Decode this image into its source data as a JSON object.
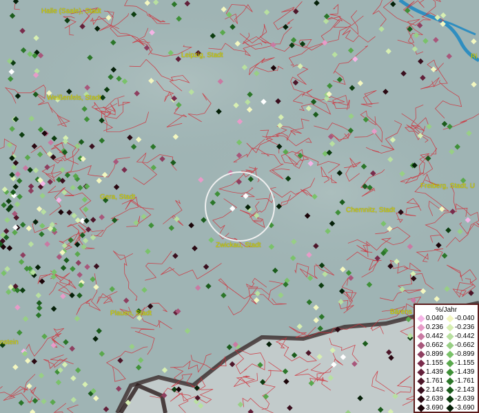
{
  "map": {
    "background_color": "#9fb4b4",
    "boundary_color": "#d0303a",
    "river_color": "#2f8ec0",
    "marker_circle_color": "#f0f0f0"
  },
  "cities": [
    {
      "id": "halle",
      "label": "Halle (Saale), Stadt"
    },
    {
      "id": "leipzig",
      "label": "Leipzig, Stadt"
    },
    {
      "id": "weissenfels",
      "label": "Weißenfels, Stadt"
    },
    {
      "id": "gera",
      "label": "Gera, Stadt"
    },
    {
      "id": "zwickau",
      "label": "Zwickau, Stadt"
    },
    {
      "id": "chemnitz",
      "label": "Chemnitz, Stadt"
    },
    {
      "id": "freiberg",
      "label": "Freiberg, Stadt, U"
    },
    {
      "id": "plauen",
      "label": "Plauen, Stadt"
    },
    {
      "id": "bärens",
      "label": "Bärens"
    },
    {
      "id": "stein",
      "label": "nstein"
    },
    {
      "id": "ri",
      "label": "Ri"
    }
  ],
  "legend": {
    "title": "%/Jahr",
    "positive": [
      {
        "value": "0.040",
        "color": "#f5b4e6"
      },
      {
        "value": "0.236",
        "color": "#e79bc8"
      },
      {
        "value": "0.442",
        "color": "#c97aa3"
      },
      {
        "value": "0.662",
        "color": "#a8577b"
      },
      {
        "value": "0.899",
        "color": "#8e3f60"
      },
      {
        "value": "1.155",
        "color": "#7a2c4c"
      },
      {
        "value": "1.439",
        "color": "#63203a"
      },
      {
        "value": "1.761",
        "color": "#4d1629"
      },
      {
        "value": "2.143",
        "color": "#3a0f1e"
      },
      {
        "value": "2.639",
        "color": "#2a0912"
      },
      {
        "value": "3.690",
        "color": "#1a0408"
      }
    ],
    "negative": [
      {
        "value": "-0.040",
        "color": "#f3f7c0"
      },
      {
        "value": "-0.236",
        "color": "#d7efb2"
      },
      {
        "value": "-0.442",
        "color": "#b8e0a0"
      },
      {
        "value": "-0.662",
        "color": "#98cf85"
      },
      {
        "value": "-0.899",
        "color": "#7ac26a"
      },
      {
        "value": "-1.155",
        "color": "#5aa84d"
      },
      {
        "value": "-1.439",
        "color": "#3f9038"
      },
      {
        "value": "-1.761",
        "color": "#2b7629"
      },
      {
        "value": "-2.143",
        "color": "#1b5c1c"
      },
      {
        "value": "-2.639",
        "color": "#0d3d10"
      },
      {
        "value": "-3.690",
        "color": "#052008"
      }
    ]
  }
}
